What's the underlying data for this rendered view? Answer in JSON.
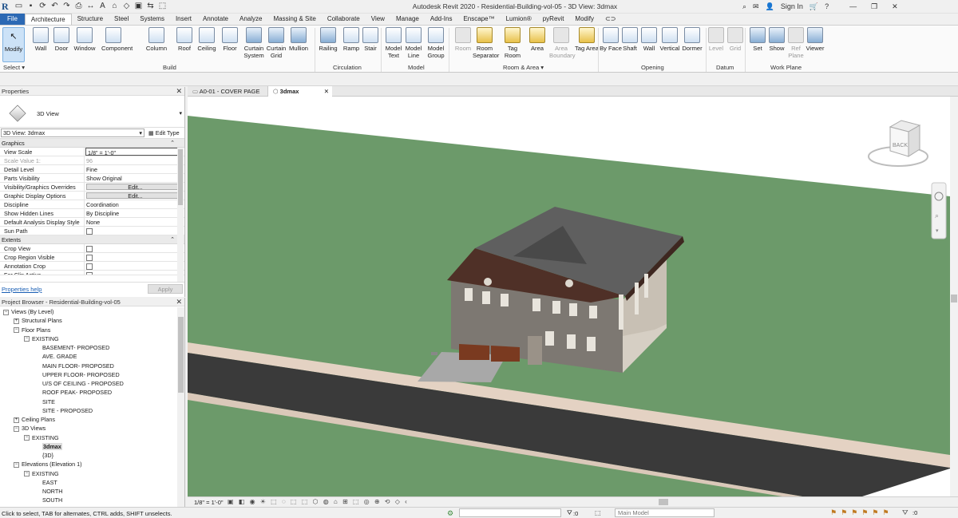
{
  "app": {
    "logo": "R",
    "title": "Autodesk Revit 2020 - Residential-Building-vol-05 - 3D View: 3dmax",
    "sign_in": "Sign In",
    "qat_icons": [
      "open-icon",
      "save-icon",
      "sync-icon",
      "undo-icon",
      "redo-icon",
      "print-icon",
      "measure-icon",
      "text-icon",
      "3d-view-icon",
      "section-icon",
      "close-hidden-icon",
      "switch-icon",
      "select-icon"
    ]
  },
  "menu": [
    "File",
    "Architecture",
    "Structure",
    "Steel",
    "Systems",
    "Insert",
    "Annotate",
    "Analyze",
    "Massing & Site",
    "Collaborate",
    "View",
    "Manage",
    "Add-Ins",
    "Enscape™",
    "Lumion®",
    "pyRevit",
    "Modify"
  ],
  "active_menu": "Architecture",
  "ribbon": {
    "modify": "Modify",
    "select": "Select ▾",
    "tools": [
      {
        "name": "wall",
        "label": "Wall"
      },
      {
        "name": "door",
        "label": "Door"
      },
      {
        "name": "window",
        "label": "Window"
      },
      {
        "name": "component",
        "label": "Component"
      },
      {
        "name": "column",
        "label": "Column"
      },
      {
        "name": "roof",
        "label": "Roof"
      },
      {
        "name": "ceiling",
        "label": "Ceiling"
      },
      {
        "name": "floor",
        "label": "Floor"
      },
      {
        "name": "curtain-system",
        "label": "Curtain System"
      },
      {
        "name": "curtain-grid",
        "label": "Curtain Grid"
      },
      {
        "name": "mullion",
        "label": "Mullion"
      },
      {
        "name": "railing",
        "label": "Railing"
      },
      {
        "name": "ramp",
        "label": "Ramp"
      },
      {
        "name": "stair",
        "label": "Stair"
      },
      {
        "name": "model-text",
        "label": "Model Text"
      },
      {
        "name": "model-line",
        "label": "Model Line"
      },
      {
        "name": "model-group",
        "label": "Model Group"
      },
      {
        "name": "room",
        "label": "Room"
      },
      {
        "name": "room-separator",
        "label": "Room Separator"
      },
      {
        "name": "tag-room",
        "label": "Tag Room"
      },
      {
        "name": "area",
        "label": "Area"
      },
      {
        "name": "area-boundary",
        "label": "Area Boundary"
      },
      {
        "name": "tag-area",
        "label": "Tag Area"
      },
      {
        "name": "by-face",
        "label": "By Face"
      },
      {
        "name": "shaft",
        "label": "Shaft"
      },
      {
        "name": "wall-opening",
        "label": "Wall"
      },
      {
        "name": "vertical",
        "label": "Vertical"
      },
      {
        "name": "dormer",
        "label": "Dormer"
      },
      {
        "name": "level",
        "label": "Level"
      },
      {
        "name": "grid",
        "label": "Grid"
      },
      {
        "name": "set",
        "label": "Set"
      },
      {
        "name": "show",
        "label": "Show"
      },
      {
        "name": "ref-plane",
        "label": "Ref Plane"
      },
      {
        "name": "viewer",
        "label": "Viewer"
      }
    ],
    "groups": [
      "Build",
      "Circulation",
      "Model",
      "Room & Area ▾",
      "Opening",
      "Datum",
      "Work Plane"
    ]
  },
  "properties": {
    "title": "Properties",
    "type_name": "3D View",
    "selector": "3D View: 3dmax",
    "edit_type": "Edit Type",
    "sections": {
      "graphics": "Graphics",
      "extents": "Extents"
    },
    "rows": [
      {
        "k": "View Scale",
        "v": "1/8\" = 1'-0\""
      },
      {
        "k": "Scale Value    1:",
        "v": "96"
      },
      {
        "k": "Detail Level",
        "v": "Fine"
      },
      {
        "k": "Parts Visibility",
        "v": "Show Original"
      },
      {
        "k": "Visibility/Graphics Overrides",
        "v": "Edit..."
      },
      {
        "k": "Graphic Display Options",
        "v": "Edit..."
      },
      {
        "k": "Discipline",
        "v": "Coordination"
      },
      {
        "k": "Show Hidden Lines",
        "v": "By Discipline"
      },
      {
        "k": "Default Analysis Display Style",
        "v": "None"
      },
      {
        "k": "Sun Path",
        "v": ""
      }
    ],
    "extent_rows": [
      {
        "k": "Crop View"
      },
      {
        "k": "Crop Region Visible"
      },
      {
        "k": "Annotation Crop"
      },
      {
        "k": "Far Clip Active"
      }
    ],
    "help": "Properties help",
    "apply": "Apply"
  },
  "browser": {
    "title": "Project Browser - Residential-Building-vol-05",
    "items": [
      {
        "t": "Views (By Level)",
        "lvl": 0,
        "e": "−"
      },
      {
        "t": "Structural Plans",
        "lvl": 1,
        "e": "+"
      },
      {
        "t": "Floor Plans",
        "lvl": 1,
        "e": "−"
      },
      {
        "t": "EXISTING",
        "lvl": 2,
        "e": "−"
      },
      {
        "t": "BASEMENT- PROPOSED",
        "lvl": 3,
        "e": ""
      },
      {
        "t": "AVE. GRADE",
        "lvl": 3,
        "e": ""
      },
      {
        "t": "MAIN FLOOR- PROPOSED",
        "lvl": 3,
        "e": ""
      },
      {
        "t": "UPPER FLOOR- PROPOSED",
        "lvl": 3,
        "e": ""
      },
      {
        "t": "U/S OF CEILING - PROPOSED",
        "lvl": 3,
        "e": ""
      },
      {
        "t": "ROOF PEAK- PROPOSED",
        "lvl": 3,
        "e": ""
      },
      {
        "t": "SITE",
        "lvl": 3,
        "e": ""
      },
      {
        "t": "SITE - PROPOSED",
        "lvl": 3,
        "e": ""
      },
      {
        "t": "Ceiling Plans",
        "lvl": 1,
        "e": "+"
      },
      {
        "t": "3D Views",
        "lvl": 1,
        "e": "−"
      },
      {
        "t": "EXISTING",
        "lvl": 2,
        "e": "−"
      },
      {
        "t": "3dmax",
        "lvl": 3,
        "e": "",
        "sel": true
      },
      {
        "t": "{3D}",
        "lvl": 3,
        "e": ""
      },
      {
        "t": "Elevations (Elevation 1)",
        "lvl": 1,
        "e": "−"
      },
      {
        "t": "EXISTING",
        "lvl": 2,
        "e": "−"
      },
      {
        "t": "EAST",
        "lvl": 3,
        "e": ""
      },
      {
        "t": "NORTH",
        "lvl": 3,
        "e": ""
      },
      {
        "t": "SOUTH",
        "lvl": 3,
        "e": ""
      }
    ]
  },
  "view_tabs": [
    {
      "label": "A0-01 - COVER PAGE",
      "active": false
    },
    {
      "label": "3dmax",
      "active": true
    }
  ],
  "viewcube": "BACK",
  "view_bar": {
    "scale": "1/8\" = 1'-0\""
  },
  "status": {
    "hint": "Click to select, TAB for alternates, CTRL adds, SHIFT unselects.",
    "count": ":0",
    "model": "Main Model"
  },
  "colors": {
    "file_tab": "#2c69b4",
    "grass": "#6c9a6a",
    "road": "#3a3a3a",
    "sidewalk": "#e4d2c3",
    "roof": "#5a3a30",
    "wall": "#cfc8bd"
  }
}
